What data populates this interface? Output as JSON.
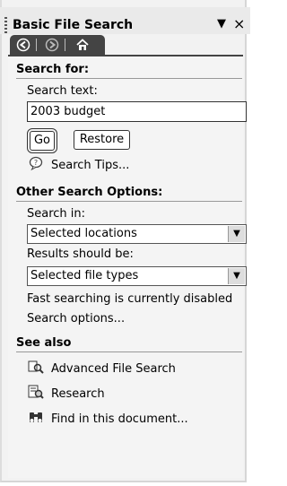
{
  "pane": {
    "title": "Basic File Search",
    "dropdown_glyph": "▼",
    "close_glyph": "×"
  },
  "nav": {
    "back_icon": "back-arrow-icon",
    "forward_icon": "forward-arrow-icon",
    "home_icon": "home-icon"
  },
  "search_for": {
    "heading": "Search for:",
    "text_label": "Search text:",
    "text_value": "2003 budget",
    "go_label": "Go",
    "restore_label": "Restore",
    "tips_label": "Search Tips..."
  },
  "other_options": {
    "heading": "Other Search Options:",
    "search_in_label": "Search in:",
    "search_in_value": "Selected locations",
    "results_label": "Results should be:",
    "results_value": "Selected file types",
    "fast_search_status": "Fast searching is currently disabled",
    "search_options_link": "Search options..."
  },
  "see_also": {
    "heading": "See also",
    "items": [
      {
        "label": "Advanced File Search",
        "icon": "advanced-search-icon"
      },
      {
        "label": "Research",
        "icon": "research-icon"
      },
      {
        "label": "Find in this document...",
        "icon": "binoculars-icon"
      }
    ]
  }
}
